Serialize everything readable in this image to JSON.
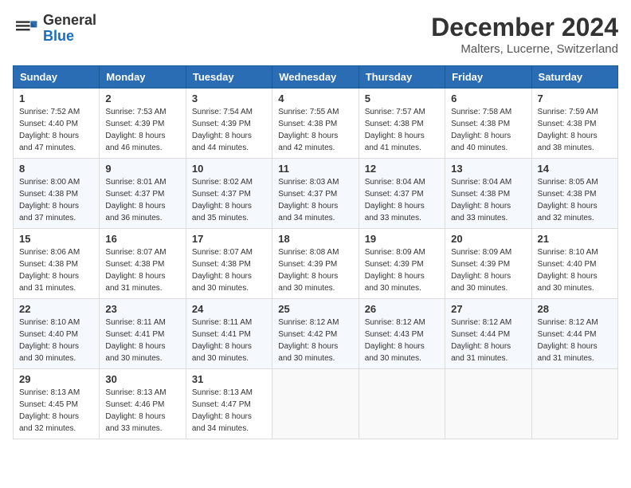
{
  "logo": {
    "general": "General",
    "blue": "Blue"
  },
  "title": "December 2024",
  "location": "Malters, Lucerne, Switzerland",
  "days_of_week": [
    "Sunday",
    "Monday",
    "Tuesday",
    "Wednesday",
    "Thursday",
    "Friday",
    "Saturday"
  ],
  "weeks": [
    [
      {
        "day": "1",
        "sunrise": "7:52 AM",
        "sunset": "4:40 PM",
        "daylight": "8 hours and 47 minutes."
      },
      {
        "day": "2",
        "sunrise": "7:53 AM",
        "sunset": "4:39 PM",
        "daylight": "8 hours and 46 minutes."
      },
      {
        "day": "3",
        "sunrise": "7:54 AM",
        "sunset": "4:39 PM",
        "daylight": "8 hours and 44 minutes."
      },
      {
        "day": "4",
        "sunrise": "7:55 AM",
        "sunset": "4:38 PM",
        "daylight": "8 hours and 42 minutes."
      },
      {
        "day": "5",
        "sunrise": "7:57 AM",
        "sunset": "4:38 PM",
        "daylight": "8 hours and 41 minutes."
      },
      {
        "day": "6",
        "sunrise": "7:58 AM",
        "sunset": "4:38 PM",
        "daylight": "8 hours and 40 minutes."
      },
      {
        "day": "7",
        "sunrise": "7:59 AM",
        "sunset": "4:38 PM",
        "daylight": "8 hours and 38 minutes."
      }
    ],
    [
      {
        "day": "8",
        "sunrise": "8:00 AM",
        "sunset": "4:38 PM",
        "daylight": "8 hours and 37 minutes."
      },
      {
        "day": "9",
        "sunrise": "8:01 AM",
        "sunset": "4:37 PM",
        "daylight": "8 hours and 36 minutes."
      },
      {
        "day": "10",
        "sunrise": "8:02 AM",
        "sunset": "4:37 PM",
        "daylight": "8 hours and 35 minutes."
      },
      {
        "day": "11",
        "sunrise": "8:03 AM",
        "sunset": "4:37 PM",
        "daylight": "8 hours and 34 minutes."
      },
      {
        "day": "12",
        "sunrise": "8:04 AM",
        "sunset": "4:37 PM",
        "daylight": "8 hours and 33 minutes."
      },
      {
        "day": "13",
        "sunrise": "8:04 AM",
        "sunset": "4:38 PM",
        "daylight": "8 hours and 33 minutes."
      },
      {
        "day": "14",
        "sunrise": "8:05 AM",
        "sunset": "4:38 PM",
        "daylight": "8 hours and 32 minutes."
      }
    ],
    [
      {
        "day": "15",
        "sunrise": "8:06 AM",
        "sunset": "4:38 PM",
        "daylight": "8 hours and 31 minutes."
      },
      {
        "day": "16",
        "sunrise": "8:07 AM",
        "sunset": "4:38 PM",
        "daylight": "8 hours and 31 minutes."
      },
      {
        "day": "17",
        "sunrise": "8:07 AM",
        "sunset": "4:38 PM",
        "daylight": "8 hours and 30 minutes."
      },
      {
        "day": "18",
        "sunrise": "8:08 AM",
        "sunset": "4:39 PM",
        "daylight": "8 hours and 30 minutes."
      },
      {
        "day": "19",
        "sunrise": "8:09 AM",
        "sunset": "4:39 PM",
        "daylight": "8 hours and 30 minutes."
      },
      {
        "day": "20",
        "sunrise": "8:09 AM",
        "sunset": "4:39 PM",
        "daylight": "8 hours and 30 minutes."
      },
      {
        "day": "21",
        "sunrise": "8:10 AM",
        "sunset": "4:40 PM",
        "daylight": "8 hours and 30 minutes."
      }
    ],
    [
      {
        "day": "22",
        "sunrise": "8:10 AM",
        "sunset": "4:40 PM",
        "daylight": "8 hours and 30 minutes."
      },
      {
        "day": "23",
        "sunrise": "8:11 AM",
        "sunset": "4:41 PM",
        "daylight": "8 hours and 30 minutes."
      },
      {
        "day": "24",
        "sunrise": "8:11 AM",
        "sunset": "4:41 PM",
        "daylight": "8 hours and 30 minutes."
      },
      {
        "day": "25",
        "sunrise": "8:12 AM",
        "sunset": "4:42 PM",
        "daylight": "8 hours and 30 minutes."
      },
      {
        "day": "26",
        "sunrise": "8:12 AM",
        "sunset": "4:43 PM",
        "daylight": "8 hours and 30 minutes."
      },
      {
        "day": "27",
        "sunrise": "8:12 AM",
        "sunset": "4:44 PM",
        "daylight": "8 hours and 31 minutes."
      },
      {
        "day": "28",
        "sunrise": "8:12 AM",
        "sunset": "4:44 PM",
        "daylight": "8 hours and 31 minutes."
      }
    ],
    [
      {
        "day": "29",
        "sunrise": "8:13 AM",
        "sunset": "4:45 PM",
        "daylight": "8 hours and 32 minutes."
      },
      {
        "day": "30",
        "sunrise": "8:13 AM",
        "sunset": "4:46 PM",
        "daylight": "8 hours and 33 minutes."
      },
      {
        "day": "31",
        "sunrise": "8:13 AM",
        "sunset": "4:47 PM",
        "daylight": "8 hours and 34 minutes."
      },
      null,
      null,
      null,
      null
    ]
  ]
}
